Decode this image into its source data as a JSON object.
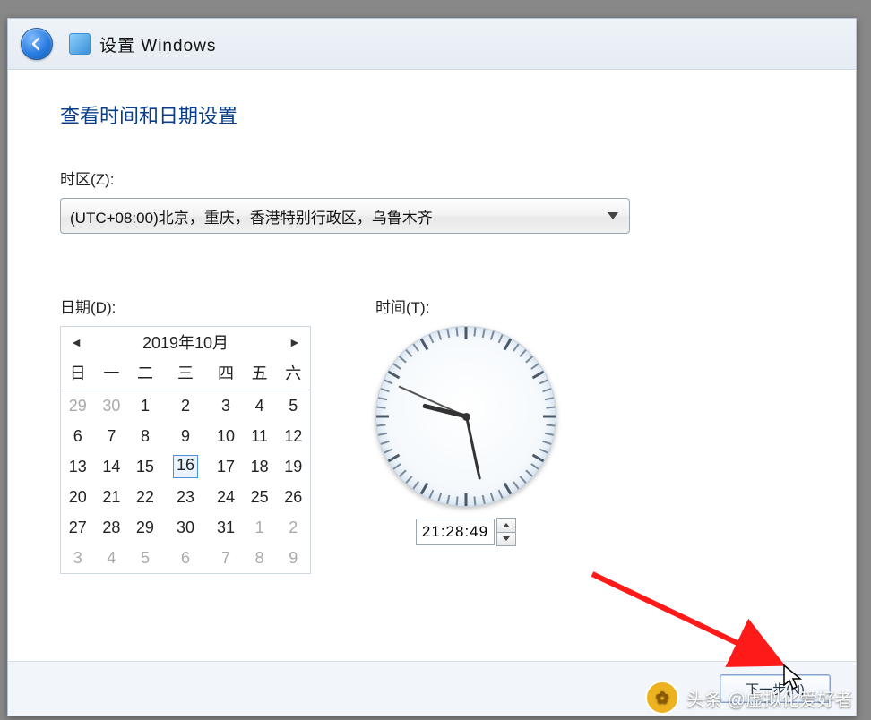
{
  "titlebar": {
    "title": "设置 Windows"
  },
  "page": {
    "heading": "查看时间和日期设置"
  },
  "timezone": {
    "label": "时区(Z):",
    "value": "(UTC+08:00)北京，重庆，香港特别行政区，乌鲁木齐"
  },
  "date": {
    "label": "日期(D):",
    "month_label": "2019年10月",
    "weekdays": [
      "日",
      "一",
      "二",
      "三",
      "四",
      "五",
      "六"
    ],
    "weeks": [
      [
        {
          "d": "29",
          "other": true
        },
        {
          "d": "30",
          "other": true
        },
        {
          "d": "1"
        },
        {
          "d": "2"
        },
        {
          "d": "3"
        },
        {
          "d": "4"
        },
        {
          "d": "5"
        }
      ],
      [
        {
          "d": "6"
        },
        {
          "d": "7"
        },
        {
          "d": "8"
        },
        {
          "d": "9"
        },
        {
          "d": "10"
        },
        {
          "d": "11"
        },
        {
          "d": "12"
        }
      ],
      [
        {
          "d": "13"
        },
        {
          "d": "14"
        },
        {
          "d": "15"
        },
        {
          "d": "16",
          "selected": true
        },
        {
          "d": "17"
        },
        {
          "d": "18"
        },
        {
          "d": "19"
        }
      ],
      [
        {
          "d": "20"
        },
        {
          "d": "21"
        },
        {
          "d": "22"
        },
        {
          "d": "23"
        },
        {
          "d": "24"
        },
        {
          "d": "25"
        },
        {
          "d": "26"
        }
      ],
      [
        {
          "d": "27"
        },
        {
          "d": "28"
        },
        {
          "d": "29"
        },
        {
          "d": "30"
        },
        {
          "d": "31"
        },
        {
          "d": "1",
          "other": true
        },
        {
          "d": "2",
          "other": true
        }
      ],
      [
        {
          "d": "3",
          "other": true
        },
        {
          "d": "4",
          "other": true
        },
        {
          "d": "5",
          "other": true
        },
        {
          "d": "6",
          "other": true
        },
        {
          "d": "7",
          "other": true
        },
        {
          "d": "8",
          "other": true
        },
        {
          "d": "9",
          "other": true
        }
      ]
    ]
  },
  "time": {
    "label": "时间(T):",
    "value": "21:28:49",
    "hour": 21,
    "minute": 28,
    "second": 49
  },
  "footer": {
    "next_label": "下一步(N)"
  },
  "watermark": {
    "text": "头条 @虚拟化爱好者"
  }
}
